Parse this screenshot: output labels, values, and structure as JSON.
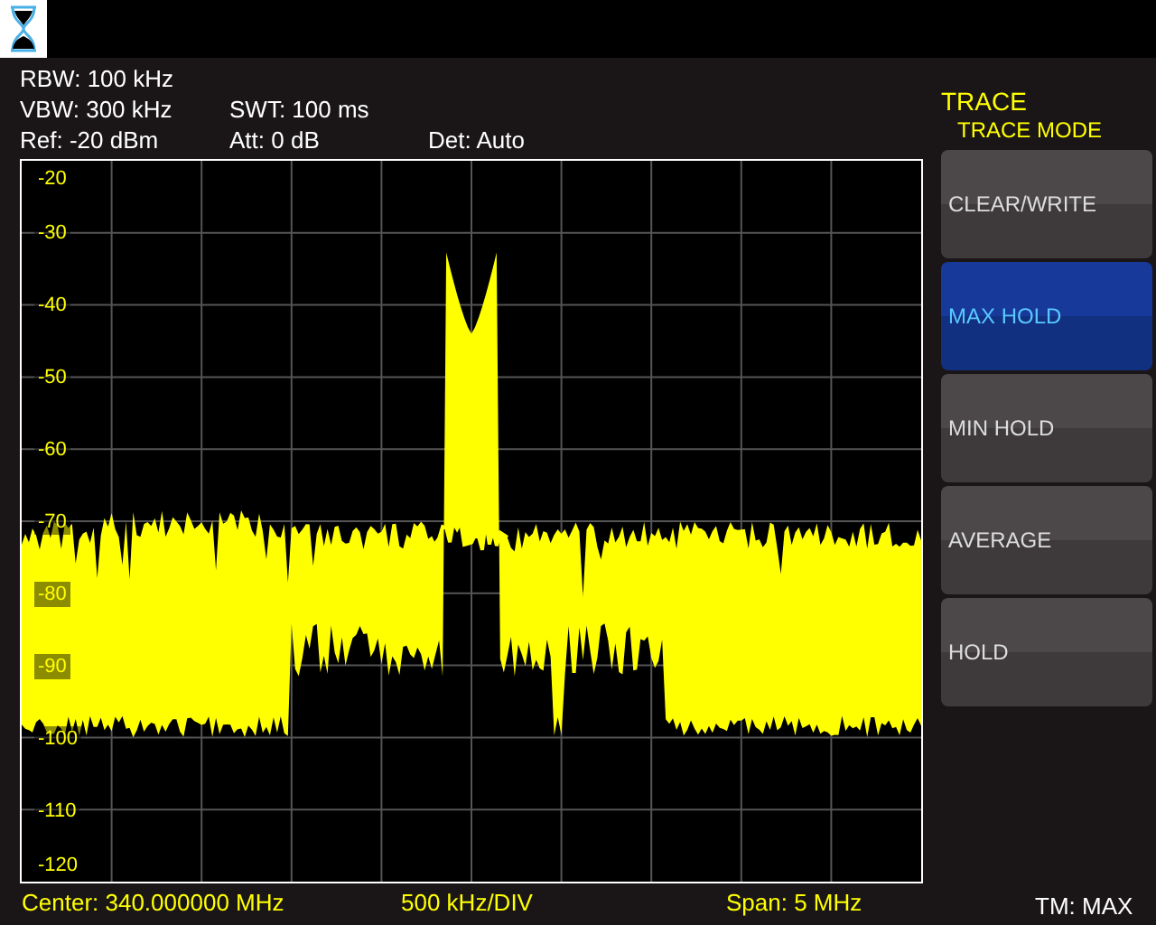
{
  "info": {
    "rbw": "RBW: 100 kHz",
    "vbw": "VBW: 300 kHz",
    "swt": "SWT: 100 ms",
    "ref": "Ref: -20 dBm",
    "att": "Att: 0 dB",
    "det": "Det: Auto"
  },
  "menu": {
    "title": "TRACE",
    "subtitle": "TRACE MODE",
    "buttons": [
      {
        "label": "CLEAR/WRITE",
        "selected": false
      },
      {
        "label": "MAX HOLD",
        "selected": true
      },
      {
        "label": "MIN HOLD",
        "selected": false
      },
      {
        "label": "AVERAGE",
        "selected": false
      },
      {
        "label": "HOLD",
        "selected": false
      }
    ]
  },
  "plot": {
    "y_labels": [
      "-20",
      "-30",
      "-40",
      "-50",
      "-60",
      "-70",
      "-80",
      "-90",
      "-100",
      "-110",
      "-120"
    ]
  },
  "footer": {
    "center": "Center: 340.000000 MHz",
    "div": "500 kHz/DIV",
    "span": "Span: 5 MHz",
    "trace_mode": "TM: MAX"
  }
}
